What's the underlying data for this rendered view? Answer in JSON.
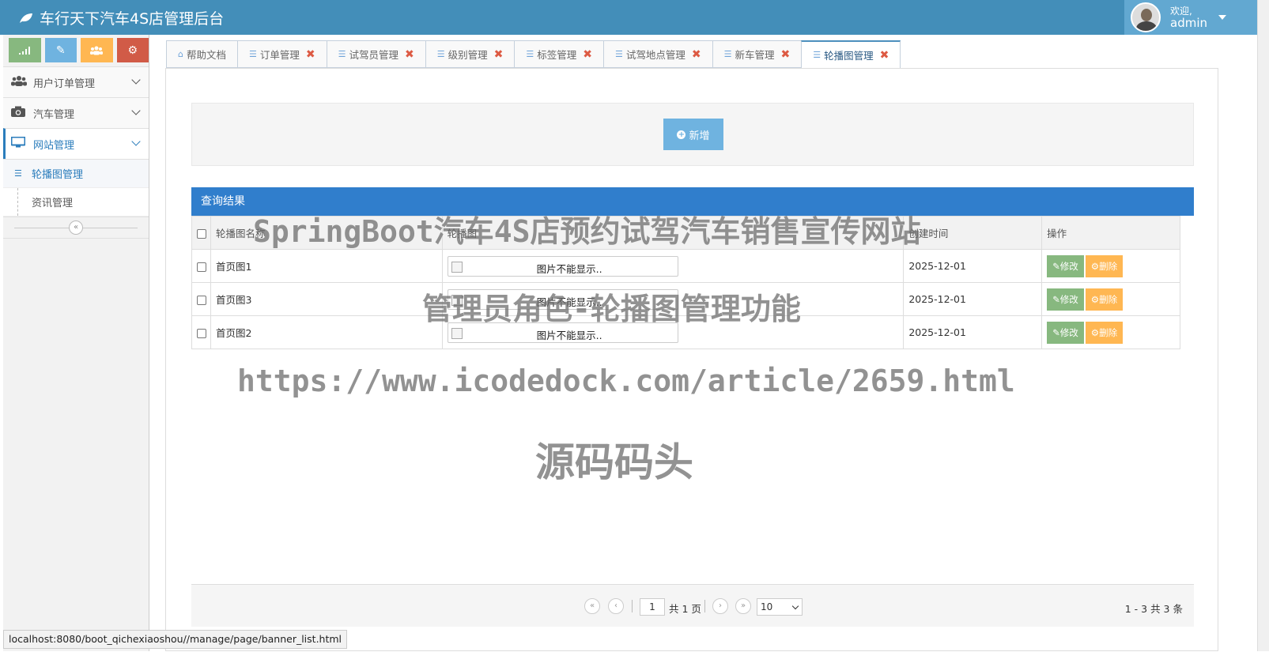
{
  "brand": {
    "title": "车行天下汽车4S店管理后台"
  },
  "user": {
    "welcome": "欢迎,",
    "name": "admin"
  },
  "colors": {
    "navbar": "#438eb9",
    "accent": "#307ecc",
    "edit": "#87b87f",
    "delete": "#ffb752",
    "add": "#6fb3e0"
  },
  "sidebar": {
    "shortcuts": [
      "signal-icon",
      "pencil-icon",
      "users-icon",
      "cogs-icon"
    ],
    "menus": [
      {
        "label": "用户订单管理",
        "icon": "users-icon"
      },
      {
        "label": "汽车管理",
        "icon": "camera-icon"
      },
      {
        "label": "网站管理",
        "icon": "desktop-icon"
      }
    ],
    "submenu": [
      {
        "label": "轮播图管理"
      },
      {
        "label": "资讯管理"
      }
    ]
  },
  "tabs": [
    {
      "label": "帮助文档"
    },
    {
      "label": "订单管理"
    },
    {
      "label": "试驾员管理"
    },
    {
      "label": "级别管理"
    },
    {
      "label": "标签管理"
    },
    {
      "label": "试驾地点管理"
    },
    {
      "label": "新车管理"
    },
    {
      "label": "轮播图管理"
    }
  ],
  "toolbar": {
    "add_label": "新增"
  },
  "result": {
    "title": "查询结果",
    "columns": [
      "轮播图名称",
      "轮播图",
      "创建时间",
      "操作"
    ],
    "rows": [
      {
        "name": "首页图1",
        "image_alt": "图片不能显示..",
        "created": "2025-12-01"
      },
      {
        "name": "首页图3",
        "image_alt": "图片不能显示..",
        "created": "2025-12-01"
      },
      {
        "name": "首页图2",
        "image_alt": "图片不能显示..",
        "created": "2025-12-01"
      }
    ],
    "edit_label": "修改",
    "delete_label": "删除"
  },
  "pager": {
    "current": "1",
    "total_text": "共 1 页",
    "page_size": "10",
    "summary": "1 - 3   共 3 条"
  },
  "watermark": {
    "line1": "SpringBoot汽车4S店预约试驾汽车销售宣传网站",
    "line2": "管理员角色-轮播图管理功能",
    "line3": "https://www.icodedock.com/article/2659.html",
    "line4": "源码码头"
  },
  "status_url": "localhost:8080/boot_qichexiaoshou//manage/page/banner_list.html"
}
